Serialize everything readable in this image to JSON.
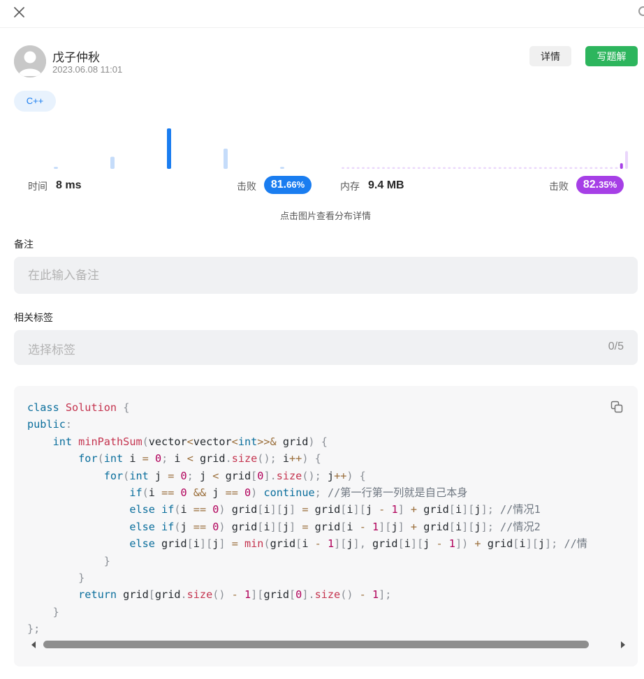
{
  "header": {
    "close_icon": "close-icon",
    "corner_icon": "circle-icon"
  },
  "author": {
    "name": "戊子仲秋",
    "time": "2023.06.08 11:01",
    "avatar_icon": "default-avatar-icon"
  },
  "actions": {
    "detail_label": "详情",
    "write_label": "写题解",
    "write_color": "#2db55d"
  },
  "language": "C++",
  "stats": {
    "time_label": "时间",
    "time_value": "8 ms",
    "time_beat_label": "击败",
    "time_beat_int": "81.",
    "time_beat_dec": "66%",
    "time_color": "#1a7df0",
    "mem_label": "内存",
    "mem_value": "9.4 MB",
    "mem_beat_label": "击败",
    "mem_beat_int": "82.",
    "mem_beat_dec": "35%",
    "mem_color": "#a63fe6",
    "hint": "点击图片查看分布详情"
  },
  "chart_data": [
    {
      "type": "bar",
      "series": [
        {
          "values": [
            0.05,
            0.3,
            1.0,
            0.5,
            0.05
          ]
        }
      ],
      "highlight_index": 2
    },
    {
      "type": "bar",
      "series": [
        {
          "values": [
            0.04,
            0.04,
            0.04,
            0.04,
            0.04,
            0.04,
            0.04,
            0.04,
            0.04,
            0.04,
            0.04,
            0.04,
            0.04,
            0.04,
            0.04,
            0.04,
            0.04,
            0.04,
            0.04,
            0.04,
            0.04,
            0.04,
            0.04,
            0.04,
            0.04,
            0.04,
            0.04,
            0.04,
            0.04,
            0.04,
            0.04,
            0.04,
            0.04,
            0.04,
            0.04,
            0.04,
            0.04,
            0.04,
            0.04,
            0.04,
            0.04,
            0.04,
            0.04,
            0.04,
            0.04,
            0.04,
            0.04,
            0.04,
            0.04,
            0.04,
            0.04,
            0.04,
            0.04,
            0.04,
            0.04,
            0.14,
            0.44,
            1.0
          ]
        }
      ],
      "highlight_index": 55
    }
  ],
  "note": {
    "label": "备注",
    "placeholder": "在此输入备注",
    "value": ""
  },
  "tags": {
    "label": "相关标签",
    "placeholder": "选择标签",
    "count": "0/5"
  },
  "code": {
    "copy_icon": "copy-icon",
    "comment1": "//第一行第一列就是自己本身",
    "comment2": "//情况1",
    "comment3": "//情况2",
    "comment4": "//情"
  }
}
